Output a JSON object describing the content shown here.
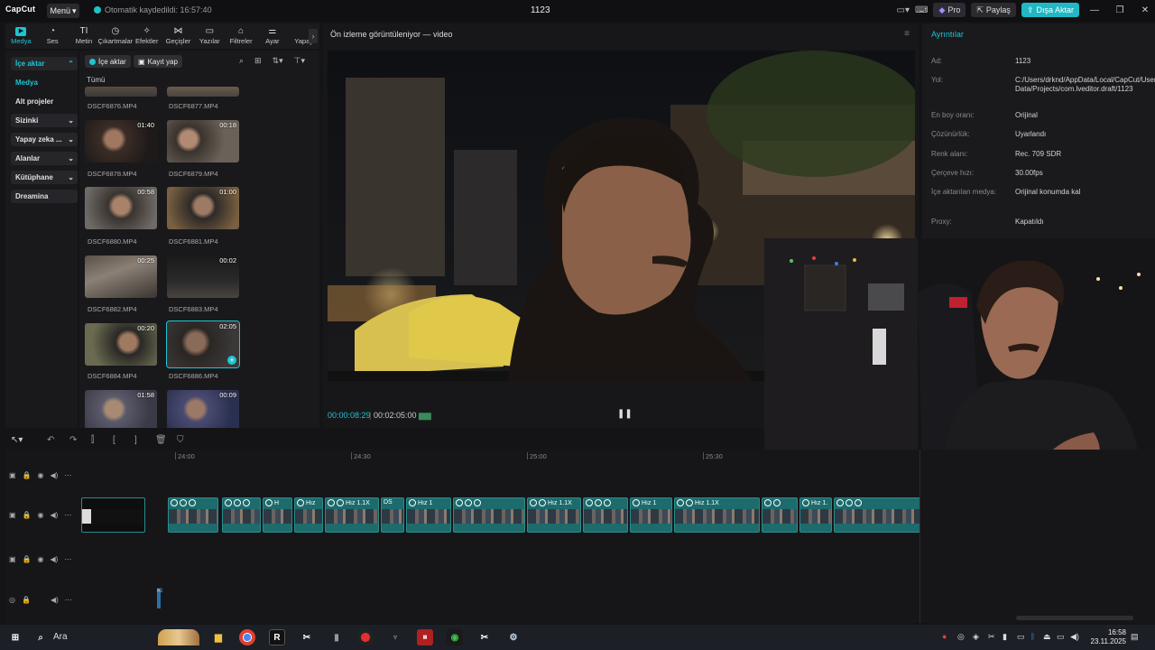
{
  "app": {
    "logo": "CapCut",
    "menu_label": "Menü",
    "autosave": "Otomatik kaydedildi: 16:57:40",
    "project_title": "1123",
    "pro_label": "Pro",
    "share_label": "Paylaş",
    "export_label": "Dışa Aktar"
  },
  "tool_tabs": [
    {
      "label": "Medya",
      "icon": "media-icon"
    },
    {
      "label": "Ses",
      "icon": "audio-icon"
    },
    {
      "label": "Metin",
      "icon": "text-icon"
    },
    {
      "label": "Çıkartmalar",
      "icon": "sticker-icon"
    },
    {
      "label": "Efektler",
      "icon": "effects-icon"
    },
    {
      "label": "Geçişler",
      "icon": "transitions-icon"
    },
    {
      "label": "Yazılar",
      "icon": "captions-icon"
    },
    {
      "label": "Filtreler",
      "icon": "filters-icon"
    },
    {
      "label": "Ayar",
      "icon": "adjust-icon"
    },
    {
      "label": "Yapay",
      "icon": "ai-icon"
    }
  ],
  "sidebar": {
    "items": [
      {
        "label": "İçe aktar"
      },
      {
        "label": "Medya"
      },
      {
        "label": "Alt projeler"
      },
      {
        "label": "Sizinki"
      },
      {
        "label": "Yapay zeka ..."
      },
      {
        "label": "Alanlar"
      },
      {
        "label": "Kütüphane"
      },
      {
        "label": "Dreamina"
      }
    ]
  },
  "media": {
    "import_label": "İçe aktar",
    "record_label": "Kayıt yap",
    "all_label": "Tümü",
    "items": [
      {
        "name": "DSCF6876.MP4",
        "duration": ""
      },
      {
        "name": "DSCF6877.MP4",
        "duration": ""
      },
      {
        "name": "DSCF6878.MP4",
        "duration": "01:40"
      },
      {
        "name": "DSCF6879.MP4",
        "duration": "00:18"
      },
      {
        "name": "DSCF6880.MP4",
        "duration": "00:58"
      },
      {
        "name": "DSCF6881.MP4",
        "duration": "01:00"
      },
      {
        "name": "DSCF6882.MP4",
        "duration": "00:25"
      },
      {
        "name": "DSCF6883.MP4",
        "duration": "00:02"
      },
      {
        "name": "DSCF6884.MP4",
        "duration": "00:20"
      },
      {
        "name": "DSCF6886.MP4",
        "duration": "02:05"
      },
      {
        "name": "",
        "duration": "01:58"
      },
      {
        "name": "",
        "duration": "00:09"
      }
    ]
  },
  "preview": {
    "title": "Ön izleme görüntüleniyor — video",
    "current_time": "00:00:08:29",
    "total_time": "00:02:05:00"
  },
  "details": {
    "title": "Ayrıntılar",
    "rows": [
      {
        "key": "Ad:",
        "value": "1123"
      },
      {
        "key": "Yol:",
        "value": "C:/Users/drknd/AppData/Local/CapCut/User Data/Projects/com.lveditor.draft/1123"
      },
      {
        "key": "En boy oranı:",
        "value": "Orijinal"
      },
      {
        "key": "Çözünürlük:",
        "value": "Uyarlandı"
      },
      {
        "key": "Renk alanı:",
        "value": "Rec. 709 SDR"
      },
      {
        "key": "Çerçeve hızı:",
        "value": "30.00fps"
      },
      {
        "key": "İçe aktarılan medya:",
        "value": "Orijinal konumda kal"
      },
      {
        "key": "Proxy:",
        "value": "Kapatıldı"
      }
    ]
  },
  "timeline": {
    "ruler": [
      "24:00",
      "24:30",
      "25:00",
      "25:30"
    ],
    "clip_labels": [
      "H",
      "Hız",
      "Hız 1.1X",
      "DS",
      "Hız 1",
      "Hız 1.1X",
      "Hız 1",
      "Hız 1.1X",
      "Hız 1."
    ],
    "audio_label": "Ki"
  },
  "taskbar": {
    "search_label": "Ara",
    "time": "16:58",
    "date": "23.11.2025"
  },
  "colors": {
    "accent": "#1fc4d0",
    "clip": "#1d6b6c",
    "export": "#1fb8c4"
  }
}
